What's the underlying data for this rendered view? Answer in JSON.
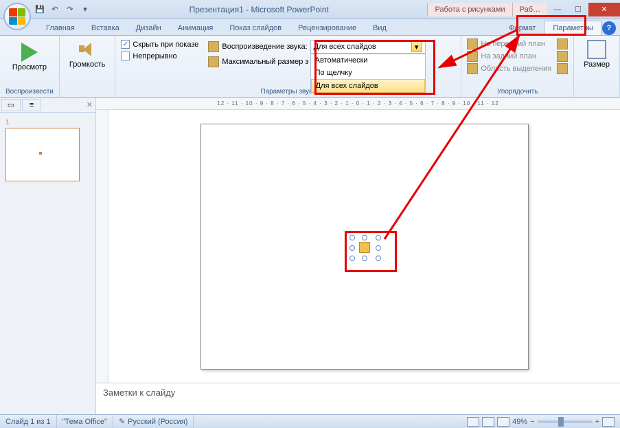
{
  "title": "Презентация1 - Microsoft PowerPoint",
  "context_tabs": {
    "a": "Работа с рисунками",
    "b": "Раб…"
  },
  "tabs": {
    "home": "Главная",
    "insert": "Вставка",
    "design": "Дизайн",
    "anim": "Анимация",
    "show": "Показ слайдов",
    "review": "Рецензирование",
    "view": "Вид",
    "format": "Формат",
    "params": "Параметры"
  },
  "ribbon": {
    "preview": "Просмотр",
    "preview_group": "Воспроизвести",
    "volume": "Громкость",
    "hide": "Скрыть при показе",
    "loop": "Непрерывно",
    "play_sound": "Воспроизведение звука:",
    "max_size": "Максимальный размер з",
    "sound_group": "Параметры звука",
    "bring_front": "На передний план",
    "send_back": "На задний план",
    "selection_pane": "Область выделения",
    "arrange_group": "Упорядочить",
    "size": "Размер"
  },
  "dropdown": {
    "selected": "Для всех слайдов",
    "opt1": "Автоматически",
    "opt2": "По щелчку",
    "opt3": "Для всех слайдов"
  },
  "thumb": {
    "num": "1"
  },
  "ruler": "12 · 11 · 10 · 9 · 8 · 7 · 6 · 5 · 4 · 3 · 2 · 1 · 0 · 1 · 2 · 3 · 4 · 5 · 6 · 7 · 8 · 9 · 10 · 11 · 12",
  "notes": "Заметки к слайду",
  "status": {
    "slide": "Слайд 1 из 1",
    "theme": "\"Тема Office\"",
    "lang": "Русский (Россия)",
    "zoom": "49%"
  }
}
